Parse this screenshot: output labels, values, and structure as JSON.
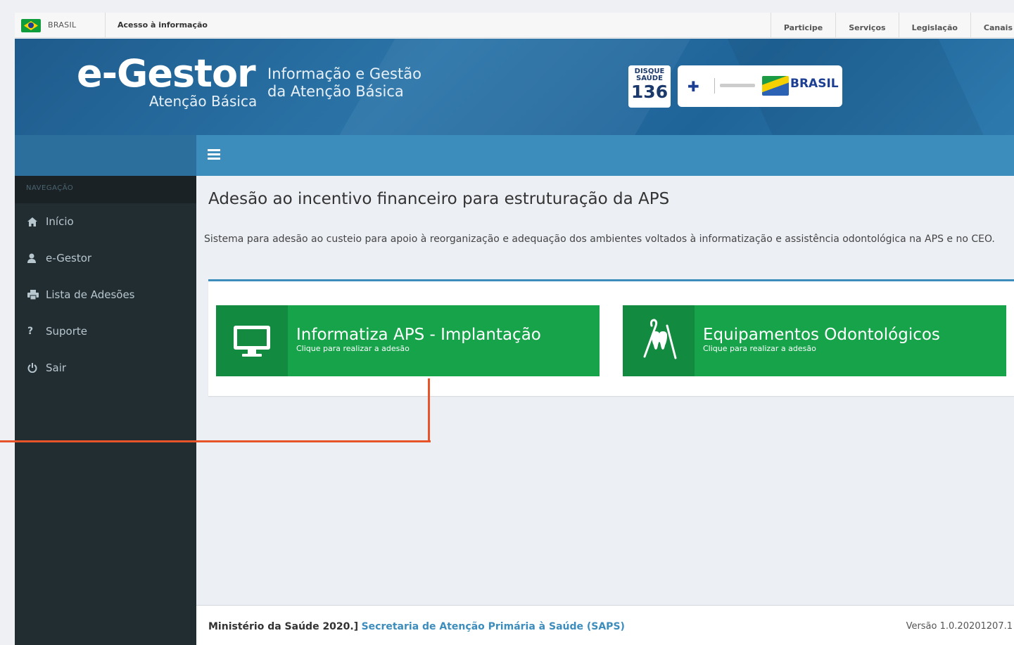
{
  "govbar": {
    "country": "BRASIL",
    "access": "Acesso à informação",
    "links": [
      "Participe",
      "Serviços",
      "Legislação",
      "Canais"
    ]
  },
  "header": {
    "logo_title": "e-Gestor",
    "logo_subtitle": "Atenção Básica",
    "tagline_line1": "Informação e Gestão",
    "tagline_line2": "da Atenção Básica",
    "disque_line1": "DISQUE",
    "disque_line2": "SAÚDE",
    "disque_number": "136",
    "gov_brand": "BRASIL"
  },
  "sidebar": {
    "header": "NAVEGAÇÃO",
    "items": [
      {
        "label": "Início",
        "icon": "home-icon"
      },
      {
        "label": "e-Gestor",
        "icon": "user-icon"
      },
      {
        "label": "Lista de Adesões",
        "icon": "print-icon"
      },
      {
        "label": "Suporte",
        "icon": "question-icon"
      },
      {
        "label": "Sair",
        "icon": "power-icon"
      }
    ]
  },
  "content": {
    "title": "Adesão ao incentivo financeiro para estruturação da APS",
    "description": "Sistema para adesão ao custeio para apoio à reorganização e adequação dos ambientes voltados à informatização e assistência odontológica na APS e no CEO.",
    "tiles": [
      {
        "title": "Informatiza APS - Implantação",
        "subtitle": "Clique para realizar a adesão",
        "icon": "monitor-icon"
      },
      {
        "title": "Equipamentos Odontológicos",
        "subtitle": "Clique para realizar a adesão",
        "icon": "dental-icon"
      }
    ]
  },
  "footer": {
    "org": "Ministério da Saúde 2020.]",
    "link": "Secretaria de Atenção Primária à Saúde (SAPS)",
    "version": "Versão 1.0.20201207.1"
  },
  "colors": {
    "header_blue": "#2b74a8",
    "topbar_blue": "#3c8dbc",
    "sidebar_dark": "#222d32",
    "tile_green": "#16a34a",
    "annotation_orange": "#e8542a"
  }
}
